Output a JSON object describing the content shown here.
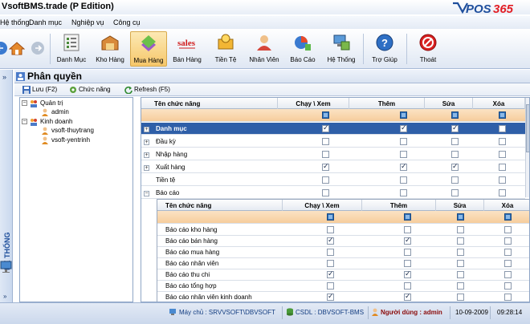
{
  "window": {
    "title": "VsoftBMS.trade (P Edition)"
  },
  "brand": {
    "logo_text": "POS365",
    "accent": "#e21e25",
    "blue": "#1f4f9d"
  },
  "menu": {
    "items": [
      {
        "label": "Hệ thống"
      },
      {
        "label": "Danh mục"
      },
      {
        "label": "Nghiệp vụ"
      },
      {
        "label": "Công cụ"
      }
    ]
  },
  "toolbar": {
    "items": [
      {
        "label": "Danh Mục",
        "icon": "list-icon"
      },
      {
        "label": "Kho Hàng",
        "icon": "warehouse-icon"
      },
      {
        "label": "Mua Hàng",
        "icon": "purchase-icon"
      },
      {
        "label": "Bán Hàng",
        "icon": "sales-icon"
      },
      {
        "label": "Tiền Tệ",
        "icon": "money-icon"
      },
      {
        "label": "Nhân Viên",
        "icon": "employee-icon"
      },
      {
        "label": "Báo Cáo",
        "icon": "report-icon"
      },
      {
        "label": "Hệ Thống",
        "icon": "system-icon"
      },
      {
        "label": "Trợ Giúp",
        "icon": "help-icon"
      },
      {
        "label": "Thoát",
        "icon": "exit-icon"
      }
    ]
  },
  "left_strip": {
    "label": "HỆ THỐNG"
  },
  "panel": {
    "title": "Phân quyền",
    "actions": [
      {
        "label": "Lưu (F2)"
      },
      {
        "label": "Chức năng"
      },
      {
        "label": "Refresh (F5)"
      }
    ]
  },
  "tree": {
    "groups": [
      {
        "label": "Quản trị",
        "children": [
          "admin"
        ]
      },
      {
        "label": "Kinh doanh",
        "children": [
          "vsoft-thuytrang",
          "vsoft-yentrinh"
        ]
      }
    ]
  },
  "grid": {
    "columns": [
      "Tên chức năng",
      "Chạy \\ Xem",
      "Thêm",
      "Sửa",
      "Xóa"
    ],
    "rows": [
      {
        "name": "Danh mục",
        "expand": "+",
        "checks": [
          true,
          true,
          true,
          false
        ],
        "selected": true
      },
      {
        "name": "Đầu kỳ",
        "expand": "+",
        "checks": [
          false,
          false,
          false,
          false
        ]
      },
      {
        "name": "Nhập hàng",
        "expand": "+",
        "checks": [
          false,
          false,
          false,
          false
        ]
      },
      {
        "name": "Xuất hàng",
        "expand": "+",
        "checks": [
          true,
          true,
          true,
          false
        ]
      },
      {
        "name": "Tiền tệ",
        "expand": "",
        "checks": [
          false,
          false,
          false,
          false
        ]
      },
      {
        "name": "Báo cáo",
        "expand": "−",
        "checks": [
          false,
          false,
          false,
          false
        ]
      }
    ]
  },
  "subgrid": {
    "columns": [
      "Tên chức năng",
      "Chạy \\ Xem",
      "Thêm",
      "Sửa",
      "Xóa"
    ],
    "rows": [
      {
        "name": "Báo cáo kho hàng",
        "checks": [
          false,
          false,
          false,
          false
        ]
      },
      {
        "name": "Báo cáo bán hàng",
        "checks": [
          true,
          true,
          false,
          false
        ]
      },
      {
        "name": "Báo cáo mua hàng",
        "checks": [
          false,
          false,
          false,
          false
        ]
      },
      {
        "name": "Báo cáo nhân viên",
        "checks": [
          false,
          false,
          false,
          false
        ]
      },
      {
        "name": "Báo cáo thu chi",
        "checks": [
          true,
          true,
          false,
          false
        ]
      },
      {
        "name": "Báo cáo tổng hợp",
        "checks": [
          false,
          false,
          false,
          false
        ]
      },
      {
        "name": "Báo cáo nhân viên kinh doanh",
        "checks": [
          true,
          true,
          false,
          false
        ]
      }
    ]
  },
  "status": {
    "server": "Máy chủ : SRVVSOFT\\DBVSOFT",
    "database": "CSDL : DBVSOFT-BMS",
    "user": "Người dùng : admin",
    "date": "10-09-2009",
    "time": "09:28:14"
  }
}
